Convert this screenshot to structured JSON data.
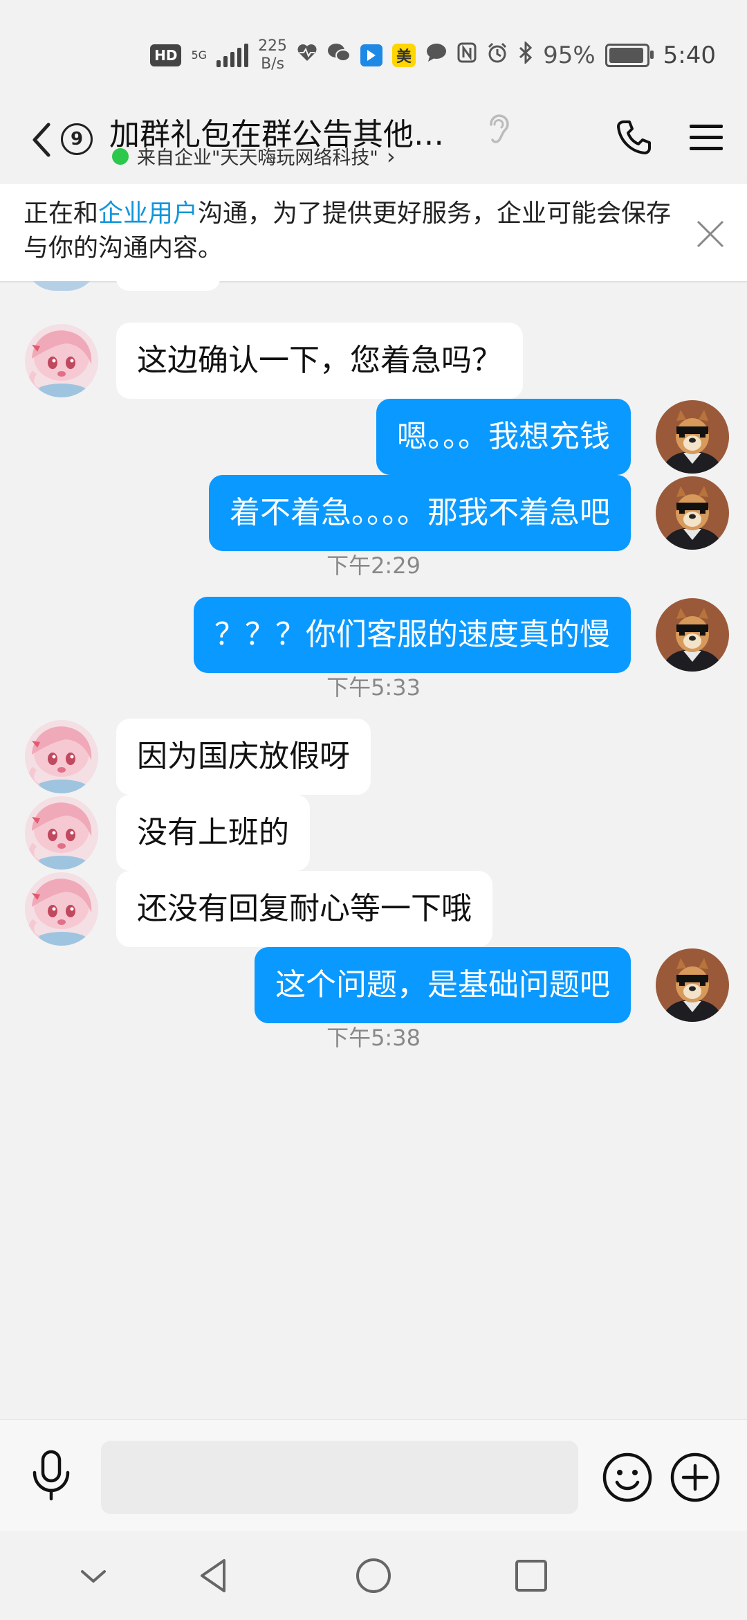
{
  "status_bar": {
    "hd": "HD",
    "net": "5G",
    "speed_value": "225",
    "speed_unit": "B/s",
    "app_meituan": "美",
    "battery": "95%",
    "battery_level": 0.95,
    "time": "5:40"
  },
  "header": {
    "unread_count": "9",
    "title": "加群礼包在群公告其他礼...",
    "subtitle": "来自企业\"天天嗨玩网络科技\"",
    "subtitle_chevron": "›"
  },
  "notice": {
    "prefix": "正在和",
    "link": "企业用户",
    "suffix": "沟通，为了提供更好服务，企业可能会保存与你的沟通内容。"
  },
  "messages": [
    {
      "side": "in",
      "text": "这边确认一下，您着急吗？"
    },
    {
      "side": "out",
      "text": "嗯。。。我想充钱"
    },
    {
      "side": "out",
      "text": "着不着急。。。。那我不着急吧"
    },
    {
      "side": "out",
      "text": "？？？你们客服的速度真的慢"
    },
    {
      "side": "in",
      "text": "因为国庆放假呀"
    },
    {
      "side": "in",
      "text": "没有上班的"
    },
    {
      "side": "in",
      "text": "还没有回复耐心等一下哦"
    },
    {
      "side": "out",
      "text": "这个问题，是基础问题吧"
    }
  ],
  "timestamps": [
    "下午2:29",
    "下午5:33",
    "下午5:38"
  ],
  "input": {
    "placeholder": ""
  },
  "colors": {
    "outgoing_bubble": "#0a99ff",
    "incoming_bubble": "#ffffff",
    "link": "#1296db",
    "online_dot": "#2bc84b"
  },
  "icons": [
    "back-icon",
    "ear-icon",
    "phone-icon",
    "menu-icon",
    "close-icon",
    "microphone-icon",
    "emoji-icon",
    "plus-icon",
    "nav-collapse-icon",
    "nav-back-icon",
    "nav-home-icon",
    "nav-recents-icon"
  ]
}
